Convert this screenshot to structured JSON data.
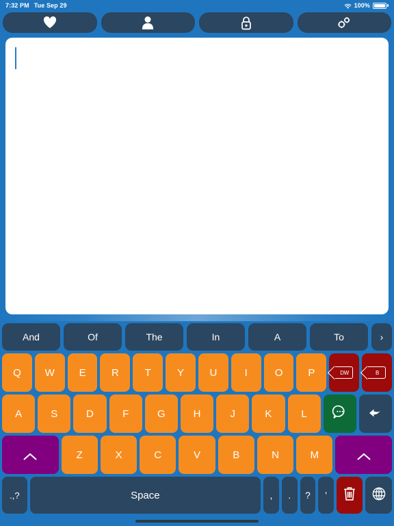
{
  "status_bar": {
    "time": "7:32 PM",
    "date": "Tue Sep 29",
    "battery_percent": "100%",
    "wifi_icon": "wifi-icon",
    "battery_icon": "battery-full-icon"
  },
  "toolbar": {
    "buttons": [
      {
        "name": "favorites-button",
        "icon": "heart-icon"
      },
      {
        "name": "profile-button",
        "icon": "person-icon"
      },
      {
        "name": "lock-button",
        "icon": "lock-icon"
      },
      {
        "name": "settings-button",
        "icon": "gears-icon"
      }
    ]
  },
  "text_area": {
    "value": "",
    "placeholder": "",
    "caret_visible": true
  },
  "suggestions": {
    "items": [
      "And",
      "Of",
      "The",
      "In",
      "A",
      "To"
    ],
    "more_label": "›"
  },
  "keyboard": {
    "row1": [
      {
        "label": "Q",
        "style": "letter"
      },
      {
        "label": "W",
        "style": "letter"
      },
      {
        "label": "E",
        "style": "letter"
      },
      {
        "label": "R",
        "style": "letter"
      },
      {
        "label": "T",
        "style": "letter"
      },
      {
        "label": "Y",
        "style": "letter"
      },
      {
        "label": "U",
        "style": "letter"
      },
      {
        "label": "I",
        "style": "letter"
      },
      {
        "label": "O",
        "style": "letter"
      },
      {
        "label": "P",
        "style": "letter"
      }
    ],
    "delete_word_label": "DW",
    "backspace_label": "B",
    "row2": [
      {
        "label": "A",
        "style": "letter"
      },
      {
        "label": "S",
        "style": "letter"
      },
      {
        "label": "D",
        "style": "letter"
      },
      {
        "label": "F",
        "style": "letter"
      },
      {
        "label": "G",
        "style": "letter"
      },
      {
        "label": "H",
        "style": "letter"
      },
      {
        "label": "J",
        "style": "letter"
      },
      {
        "label": "K",
        "style": "letter"
      },
      {
        "label": "L",
        "style": "letter"
      }
    ],
    "speak_icon": "speech-bubble-icon",
    "return_icon": "return-arrow-icon",
    "row3": [
      {
        "label": "Z",
        "style": "letter"
      },
      {
        "label": "X",
        "style": "letter"
      },
      {
        "label": "C",
        "style": "letter"
      },
      {
        "label": "V",
        "style": "letter"
      },
      {
        "label": "B",
        "style": "letter"
      },
      {
        "label": "N",
        "style": "letter"
      },
      {
        "label": "M",
        "style": "letter"
      }
    ],
    "shift_left_icon": "chevron-up-icon",
    "shift_right_icon": "chevron-up-icon",
    "symbols_label": ".,?",
    "space_label": "Space",
    "punctuation": [
      ",",
      ".",
      "?",
      "'"
    ],
    "trash_icon": "trash-icon",
    "globe_icon": "globe-icon"
  },
  "colors": {
    "background_blue": "#1f76bf",
    "key_orange": "#F78C1E",
    "key_dark": "#2b4660",
    "key_purple": "#800080",
    "key_red": "#9c0a0a",
    "key_green": "#0c6b37",
    "caret": "#2b7ac0"
  }
}
